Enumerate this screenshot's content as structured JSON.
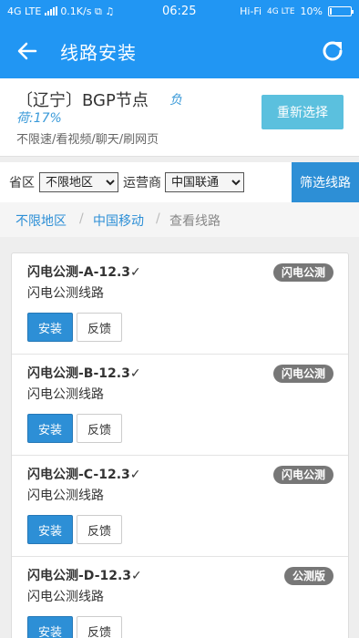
{
  "status_bar": {
    "left_text": "4G LTE",
    "speed": "0.1K/s",
    "time": "06:25",
    "wifi": "Hi-Fi",
    "network": "4G LTE",
    "battery": "10%",
    "battery_level": 0.1
  },
  "app_bar": {
    "title": "线路安装",
    "back_icon": "arrow-left-icon",
    "refresh_icon": "refresh-icon"
  },
  "node": {
    "name": "〔辽宁〕BGP节点",
    "load_prefix": "负",
    "load_value": "荷:17%",
    "description": "不限速/看视频/聊天/刷网页",
    "reselect_label": "重新选择"
  },
  "filter": {
    "province_label": "省区",
    "province_value": "不限地区",
    "carrier_label": "运营商",
    "carrier_value": "中国联通",
    "filter_button": "筛选线路"
  },
  "breadcrumb": {
    "level1": "不限地区",
    "sep": "/",
    "level2": "中国移动",
    "current": "查看线路"
  },
  "lines": [
    {
      "name": "闪电公测-A-12.3✓",
      "desc": "闪电公测线路",
      "badge": "闪电公测",
      "install": "安装",
      "feedback": "反馈"
    },
    {
      "name": "闪电公测-B-12.3✓",
      "desc": "闪电公测线路",
      "badge": "闪电公测",
      "install": "安装",
      "feedback": "反馈"
    },
    {
      "name": "闪电公测-C-12.3✓",
      "desc": "闪电公测线路",
      "badge": "闪电公测",
      "install": "安装",
      "feedback": "反馈"
    },
    {
      "name": "闪电公测-D-12.3✓",
      "desc": "闪电公测线路",
      "badge": "公测版",
      "install": "安装",
      "feedback": "反馈"
    }
  ],
  "colors": {
    "primary": "#2196f3",
    "button_blue": "#2d8fd6",
    "reselect": "#5bc0de",
    "badge": "#777777"
  }
}
